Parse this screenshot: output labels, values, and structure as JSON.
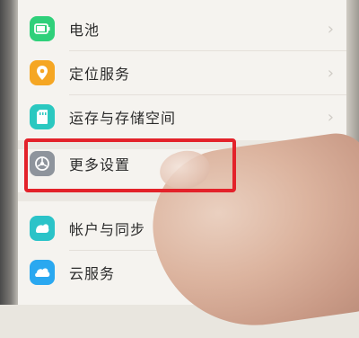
{
  "settings": {
    "items": [
      {
        "label": "电池",
        "icon": "battery-icon",
        "color": "#2fd07a"
      },
      {
        "label": "定位服务",
        "icon": "location-icon",
        "color": "#f5a623"
      },
      {
        "label": "运存与存储空间",
        "icon": "storage-icon",
        "color": "#2bc8c0"
      },
      {
        "label": "更多设置",
        "icon": "more-settings-icon",
        "color": "#8e949c"
      },
      {
        "label": "帐户与同步",
        "icon": "account-sync-icon",
        "color": "#2bc3c8"
      },
      {
        "label": "云服务",
        "icon": "cloud-icon",
        "color": "#2aa8f0"
      }
    ],
    "chevron": "›"
  },
  "colors": {
    "highlight": "#e3222a",
    "background": "#f5f3ef"
  }
}
